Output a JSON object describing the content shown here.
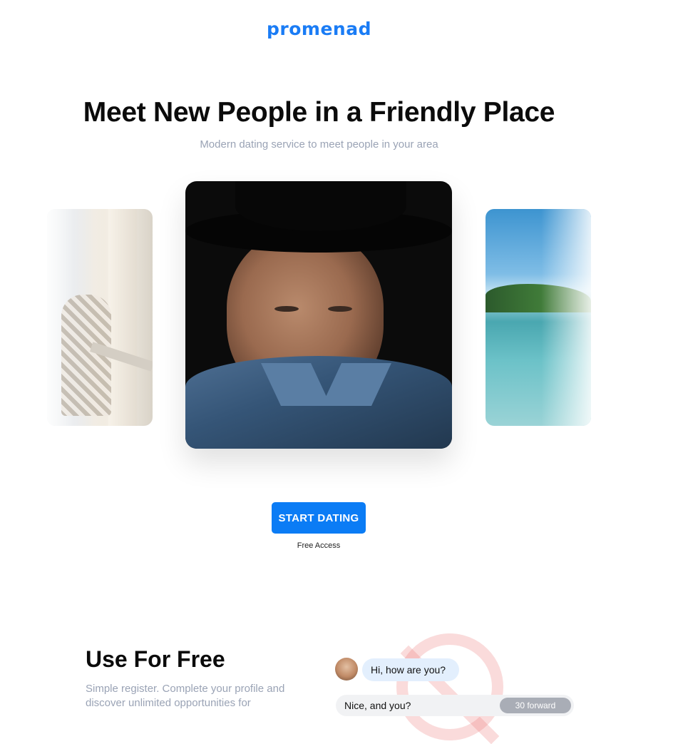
{
  "brand": {
    "logo_text": "promenad",
    "accent": "#1a7cf5"
  },
  "hero": {
    "title": "Meet New People in a Friendly Place",
    "subtitle": "Modern dating service to meet people in your area"
  },
  "cta": {
    "label": "START DATING",
    "note": "Free Access"
  },
  "section": {
    "title": "Use For Free",
    "text": "Simple register. Complete your profile and discover unlimited opportunities for"
  },
  "chat": {
    "incoming": "Hi, how are you?",
    "outgoing": "Nice, and you?",
    "outgoing_tag": "30 forward"
  }
}
